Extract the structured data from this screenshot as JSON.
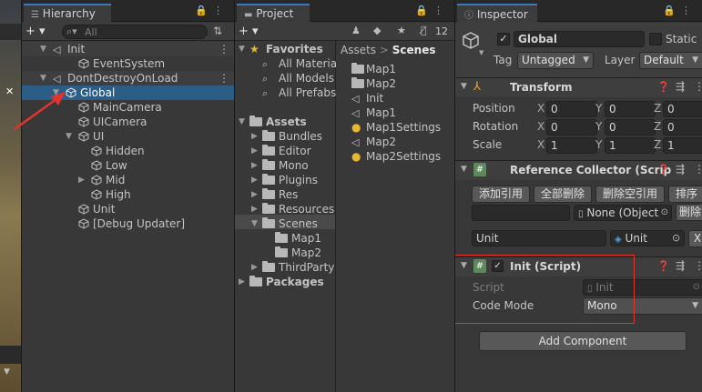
{
  "hierarchy": {
    "tab": "Hierarchy",
    "add": "+ ▾",
    "search_placeholder": "All",
    "rows": [
      {
        "label": "Init",
        "kind": "scene",
        "tri": "▼"
      },
      {
        "label": "EventSystem",
        "kind": "obj",
        "tri": ""
      },
      {
        "label": "DontDestroyOnLoad",
        "kind": "scene",
        "tri": "▼"
      },
      {
        "label": "Global",
        "kind": "obj",
        "tri": "▼"
      },
      {
        "label": "MainCamera",
        "kind": "obj",
        "tri": ""
      },
      {
        "label": "UICamera",
        "kind": "obj",
        "tri": ""
      },
      {
        "label": "UI",
        "kind": "obj",
        "tri": "▼"
      },
      {
        "label": "Hidden",
        "kind": "obj",
        "tri": ""
      },
      {
        "label": "Low",
        "kind": "obj",
        "tri": ""
      },
      {
        "label": "Mid",
        "kind": "obj",
        "tri": "▶"
      },
      {
        "label": "High",
        "kind": "obj",
        "tri": ""
      },
      {
        "label": "Unit",
        "kind": "obj",
        "tri": ""
      },
      {
        "label": "[Debug Updater]",
        "kind": "obj",
        "tri": ""
      }
    ]
  },
  "project": {
    "tab": "Project",
    "add": "+ ▾",
    "hidden_count": "12",
    "tree": [
      {
        "label": "Favorites",
        "kind": "star",
        "tri": "▼"
      },
      {
        "label": "All Materia",
        "kind": "search",
        "tri": ""
      },
      {
        "label": "All Models",
        "kind": "search",
        "tri": ""
      },
      {
        "label": "All Prefabs",
        "kind": "search",
        "tri": ""
      },
      {
        "label": "Assets",
        "kind": "folder",
        "tri": "▼"
      },
      {
        "label": "Bundles",
        "kind": "folder",
        "tri": "▶"
      },
      {
        "label": "Editor",
        "kind": "folder",
        "tri": "▶"
      },
      {
        "label": "Mono",
        "kind": "folder",
        "tri": "▶"
      },
      {
        "label": "Plugins",
        "kind": "folder",
        "tri": "▶"
      },
      {
        "label": "Res",
        "kind": "folder",
        "tri": "▶"
      },
      {
        "label": "Resources",
        "kind": "folder",
        "tri": "▶"
      },
      {
        "label": "Scenes",
        "kind": "folder",
        "tri": "▼"
      },
      {
        "label": "Map1",
        "kind": "folder",
        "tri": ""
      },
      {
        "label": "Map2",
        "kind": "folder",
        "tri": ""
      },
      {
        "label": "ThirdParty",
        "kind": "folder",
        "tri": "▶"
      },
      {
        "label": "Packages",
        "kind": "folder",
        "tri": "▶"
      }
    ],
    "breadcrumb": [
      "Assets",
      ">",
      "Scenes"
    ],
    "files": [
      {
        "label": "Map1",
        "kind": "folder"
      },
      {
        "label": "Map2",
        "kind": "folder"
      },
      {
        "label": "Init",
        "kind": "unity"
      },
      {
        "label": "Map1",
        "kind": "unity"
      },
      {
        "label": "Map1Settings",
        "kind": "settings"
      },
      {
        "label": "Map2",
        "kind": "unity"
      },
      {
        "label": "Map2Settings",
        "kind": "settings"
      }
    ]
  },
  "inspector": {
    "tab": "Inspector",
    "name": "Global",
    "static_label": "Static",
    "tag_label": "Tag",
    "tag_value": "Untagged",
    "layer_label": "Layer",
    "layer_value": "Default",
    "transform": {
      "title": "Transform",
      "rows": [
        {
          "label": "Position",
          "x": "0",
          "y": "0",
          "z": "0"
        },
        {
          "label": "Rotation",
          "x": "0",
          "y": "0",
          "z": "0"
        },
        {
          "label": "Scale",
          "x": "1",
          "y": "1",
          "z": "1"
        }
      ],
      "axes": [
        "X",
        "Y",
        "Z"
      ]
    },
    "refcollector": {
      "title": "Reference Collector (Scrip",
      "buttons": [
        "添加引用",
        "全部删除",
        "删除空引用",
        "排序"
      ],
      "none_object": "None (Object",
      "delete_label": "删除",
      "entry_key": "Unit",
      "entry_value": "Unit"
    },
    "init": {
      "title": "Init (Script)",
      "script_label": "Script",
      "script_value": "Init",
      "mode_label": "Code Mode",
      "mode_value": "Mono"
    },
    "add_component": "Add Component"
  },
  "colors": {
    "selection": "#2c5d87",
    "annotation": "#e0342c",
    "accent_tab": "#3a79bb"
  }
}
